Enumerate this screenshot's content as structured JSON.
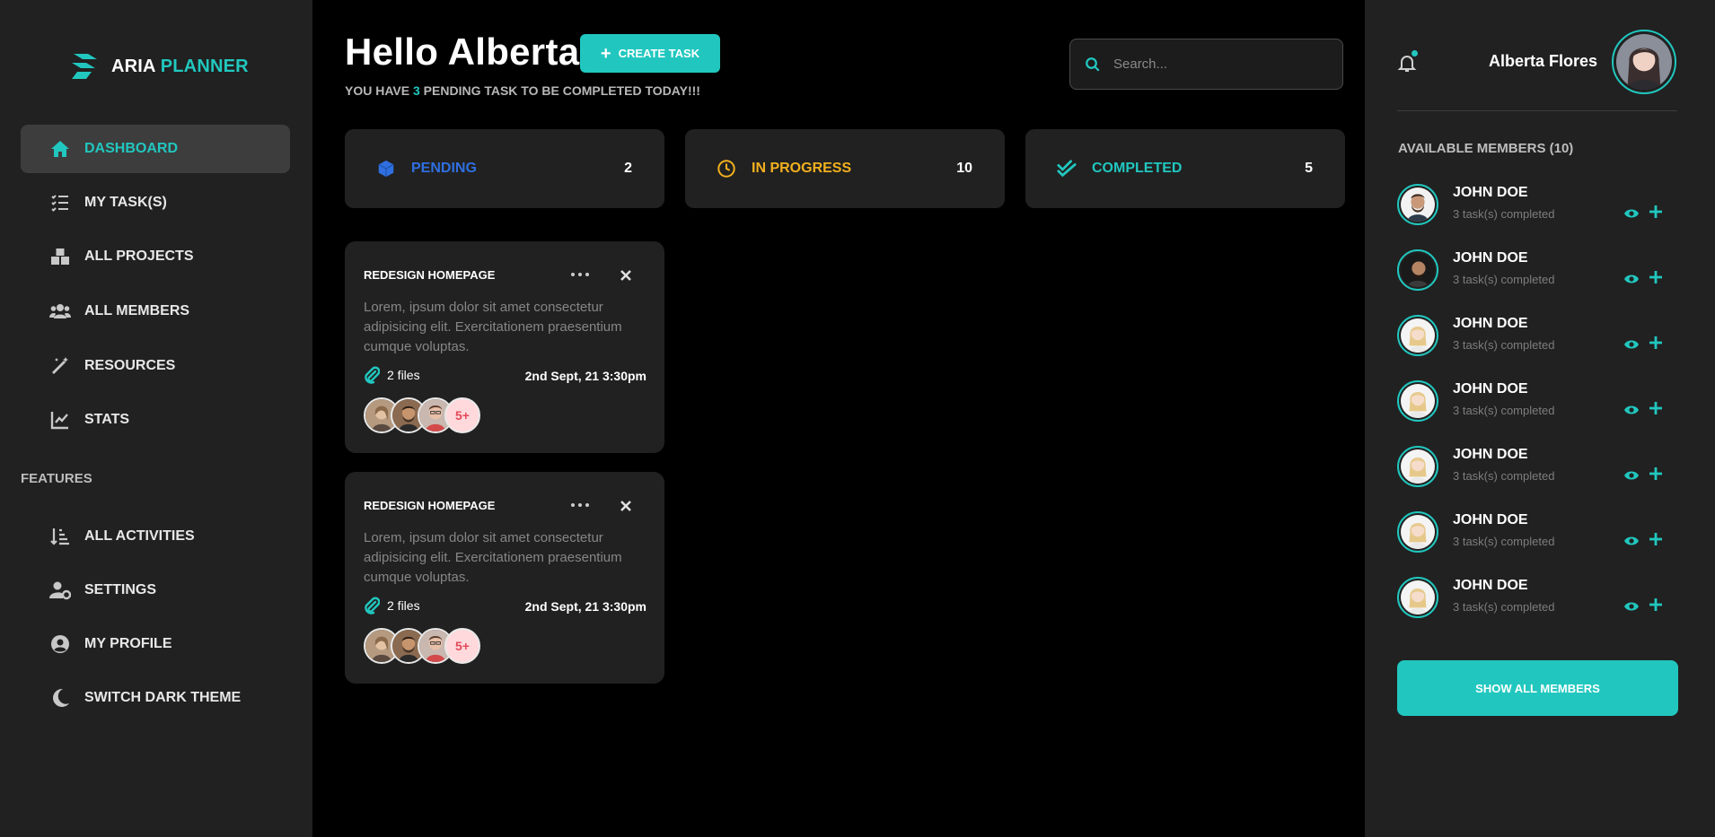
{
  "app": {
    "logo_part1": "ARIA",
    "logo_part2": "PLANNER",
    "accent": "#21c7bf"
  },
  "sidebar": {
    "items": [
      {
        "label": "DASHBOARD",
        "icon": "home-icon",
        "active": true
      },
      {
        "label": "MY TASK(S)",
        "icon": "task-list-icon"
      },
      {
        "label": "ALL PROJECTS",
        "icon": "boxes-icon"
      },
      {
        "label": "ALL MEMBERS",
        "icon": "users-icon"
      },
      {
        "label": "RESOURCES",
        "icon": "magic-wand-icon"
      },
      {
        "label": "STATS",
        "icon": "chart-line-icon"
      }
    ],
    "section_label": "FEATURES",
    "feature_items": [
      {
        "label": "ALL ACTIVITIES",
        "icon": "sort-amount-icon"
      },
      {
        "label": "SETTINGS",
        "icon": "user-cog-icon"
      },
      {
        "label": "MY PROFILE",
        "icon": "user-circle-icon"
      },
      {
        "label": "SWITCH DARK THEME",
        "icon": "moon-icon"
      }
    ]
  },
  "header": {
    "greeting": "Hello Alberta",
    "create_button": "CREATE TASK",
    "subtitle_prefix": "YOU HAVE ",
    "pending_count": "3",
    "subtitle_suffix": " PENDING TASK TO BE COMPLETED TODAY!!!",
    "search_placeholder": "Search..."
  },
  "stats": [
    {
      "label": "PENDING",
      "value": "2",
      "color": "#2f6fe0",
      "icon": "cube-icon"
    },
    {
      "label": "IN PROGRESS",
      "value": "10",
      "color": "#f2b01e",
      "icon": "clock-icon"
    },
    {
      "label": "COMPLETED",
      "value": "5",
      "color": "#21c7bf",
      "icon": "double-check-icon"
    }
  ],
  "tasks": [
    {
      "title": "REDESIGN HOMEPAGE",
      "description": "Lorem, ipsum dolor sit amet consectetur adipisicing elit. Exercitationem praesentium cumque voluptas.",
      "files": "2 files",
      "date": "2nd Sept, 21 3:30pm",
      "more_members": "5+"
    },
    {
      "title": "REDESIGN HOMEPAGE",
      "description": "Lorem, ipsum dolor sit amet consectetur adipisicing elit. Exercitationem praesentium cumque voluptas.",
      "files": "2 files",
      "date": "2nd Sept, 21 3:30pm",
      "more_members": "5+"
    }
  ],
  "profile": {
    "name": "Alberta Flores"
  },
  "members_panel": {
    "title": "AVAILABLE MEMBERS (10)",
    "members": [
      {
        "name": "JOHN DOE",
        "status": "3 task(s) completed"
      },
      {
        "name": "JOHN DOE",
        "status": "3 task(s) completed"
      },
      {
        "name": "JOHN DOE",
        "status": "3 task(s) completed"
      },
      {
        "name": "JOHN DOE",
        "status": "3 task(s) completed"
      },
      {
        "name": "JOHN DOE",
        "status": "3 task(s) completed"
      },
      {
        "name": "JOHN DOE",
        "status": "3 task(s) completed"
      },
      {
        "name": "JOHN DOE",
        "status": "3 task(s) completed"
      }
    ],
    "show_all": "SHOW ALL MEMBERS"
  }
}
